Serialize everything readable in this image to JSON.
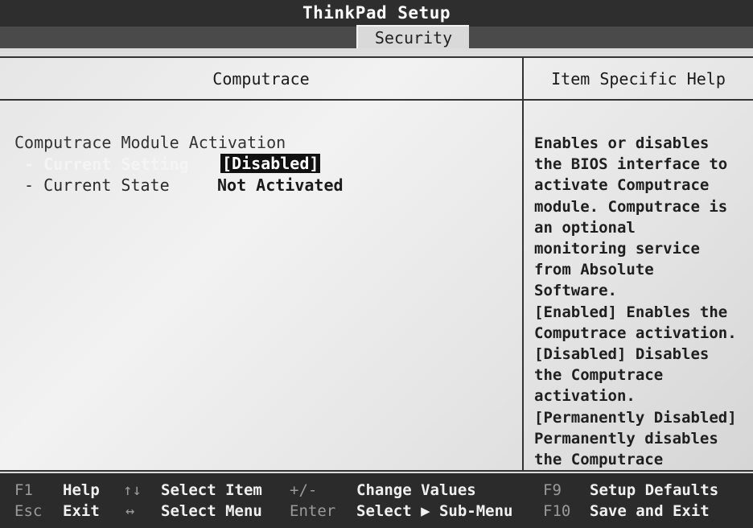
{
  "header": {
    "app_title": "ThinkPad Setup",
    "active_tab": "Security"
  },
  "left_panel": {
    "heading": "Computrace",
    "section_title": "Computrace Module Activation",
    "items": [
      {
        "label": "- Current Setting",
        "value": "[Disabled]",
        "selected": true
      },
      {
        "label": "- Current State",
        "value": "Not Activated",
        "selected": false
      }
    ]
  },
  "right_panel": {
    "heading": "Item Specific Help",
    "help_lines": [
      "Enables or disables",
      "the BIOS interface to",
      "activate Computrace",
      "module. Computrace is",
      "an optional",
      "monitoring service",
      "from Absolute",
      "Software.",
      "[Enabled] Enables the",
      "Computrace activation.",
      "[Disabled] Disables",
      "the Computrace",
      "activation.",
      "[Permanently Disabled]",
      "Permanently disables",
      "the Computrace"
    ]
  },
  "footer": {
    "f1_key": "F1",
    "f1_action": "Help",
    "esc_key": "Esc",
    "esc_action": "Exit",
    "updown_key": "↑↓",
    "updown_action": "Select Item",
    "leftright_key": "↔",
    "leftright_action": "Select Menu",
    "plusminus_key": "+/-",
    "plusminus_action": "Change Values",
    "enter_key": "Enter",
    "enter_action": "Select ▶ Sub-Menu",
    "f9_key": "F9",
    "f9_action": "Setup Defaults",
    "f10_key": "F10",
    "f10_action": "Save and Exit"
  },
  "colors": {
    "background": "#dcdcdc",
    "title_bar": "#2e2e2e",
    "highlight_bg": "#111111",
    "highlight_fg": "#ffffff"
  }
}
